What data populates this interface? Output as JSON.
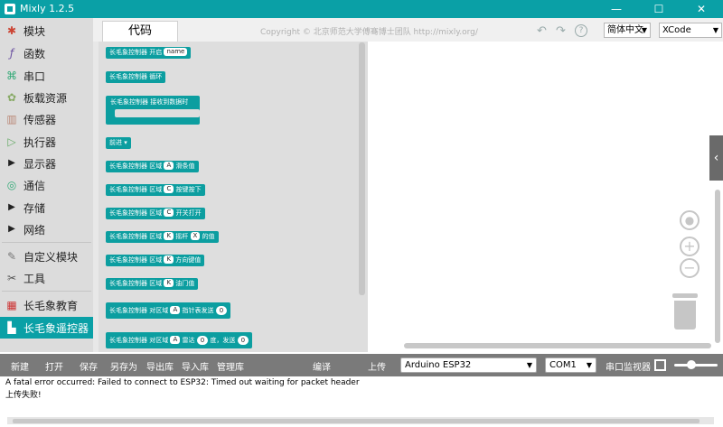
{
  "window": {
    "title": "Mixly 1.2.5",
    "minimize": "—",
    "maximize": "☐",
    "close": "✕"
  },
  "toolbar": {
    "code_tab": "代码",
    "copyright": "Copyright © 北京师范大学傅骞博士团队 http://mixly.org/",
    "language": "简体中文",
    "theme": "XCode",
    "undo": "↶",
    "redo": "↷",
    "help": "?"
  },
  "sidebar": {
    "items": [
      {
        "label": "模块",
        "icon": "puzzle-icon"
      },
      {
        "label": "函数",
        "icon": "function-icon"
      },
      {
        "label": "串口",
        "icon": "serial-icon"
      },
      {
        "label": "板载资源",
        "icon": "board-icon"
      },
      {
        "label": "传感器",
        "icon": "sensor-icon"
      },
      {
        "label": "执行器",
        "icon": "actuator-icon"
      },
      {
        "label": "显示器",
        "icon": "expand-arrow-icon"
      },
      {
        "label": "通信",
        "icon": "antenna-icon"
      },
      {
        "label": "存储",
        "icon": "expand-arrow-icon"
      },
      {
        "label": "网络",
        "icon": "expand-arrow-icon"
      },
      {
        "label": "自定义模块",
        "icon": "custom-icon"
      },
      {
        "label": "工具",
        "icon": "tools-icon"
      },
      {
        "label": "长毛象教育",
        "icon": "blocks-icon"
      },
      {
        "label": "长毛象遥控器",
        "icon": "remote-icon"
      }
    ],
    "selected": "长毛象遥控器"
  },
  "blocks": {
    "b1": "长毛象控制器 开启",
    "b1_field": "name",
    "b2": "长毛象控制器 循环",
    "b3": "长毛象控制器 接收到数据时",
    "b4": "前进",
    "b5a": "长毛象控制器 区域",
    "b5_field": "A",
    "b5b": "滑条值",
    "b6a": "长毛象控制器 区域",
    "b6_field": "C",
    "b6b": "按键按下",
    "b7a": "长毛象控制器 区域",
    "b7_field": "C",
    "b7b": "开关打开",
    "b8a": "长毛象控制器 区域",
    "b8_field": "K",
    "b8b": "摇杆",
    "b8_field2": "X",
    "b8c": "的值",
    "b9a": "长毛象控制器 区域",
    "b9_field": "K",
    "b9b": "方向键值",
    "b10a": "长毛象控制器 区域",
    "b10_field": "K",
    "b10b": "油门值",
    "b11a": "长毛象控制器 对区域",
    "b11_field": "A",
    "b11b": "指针表发送",
    "b11_num": "0",
    "b12a": "长毛象控制器 对区域",
    "b12_field": "A",
    "b12b": "雷达",
    "b12_num": "0",
    "b12c": "度，发送",
    "b12_num2": "0"
  },
  "bottombar": {
    "new": "新建",
    "open": "打开",
    "save": "保存",
    "save_as": "另存为",
    "export_lib": "导出库",
    "import_lib": "导入库",
    "manage_lib": "管理库",
    "compile": "编译",
    "upload": "上传",
    "board": "Arduino ESP32",
    "port": "COM1",
    "serial_monitor": "串口监视器"
  },
  "console": {
    "line1": "A fatal error occurred: Failed to connect to ESP32: Timed out waiting for packet header",
    "line2": "上传失败!"
  }
}
